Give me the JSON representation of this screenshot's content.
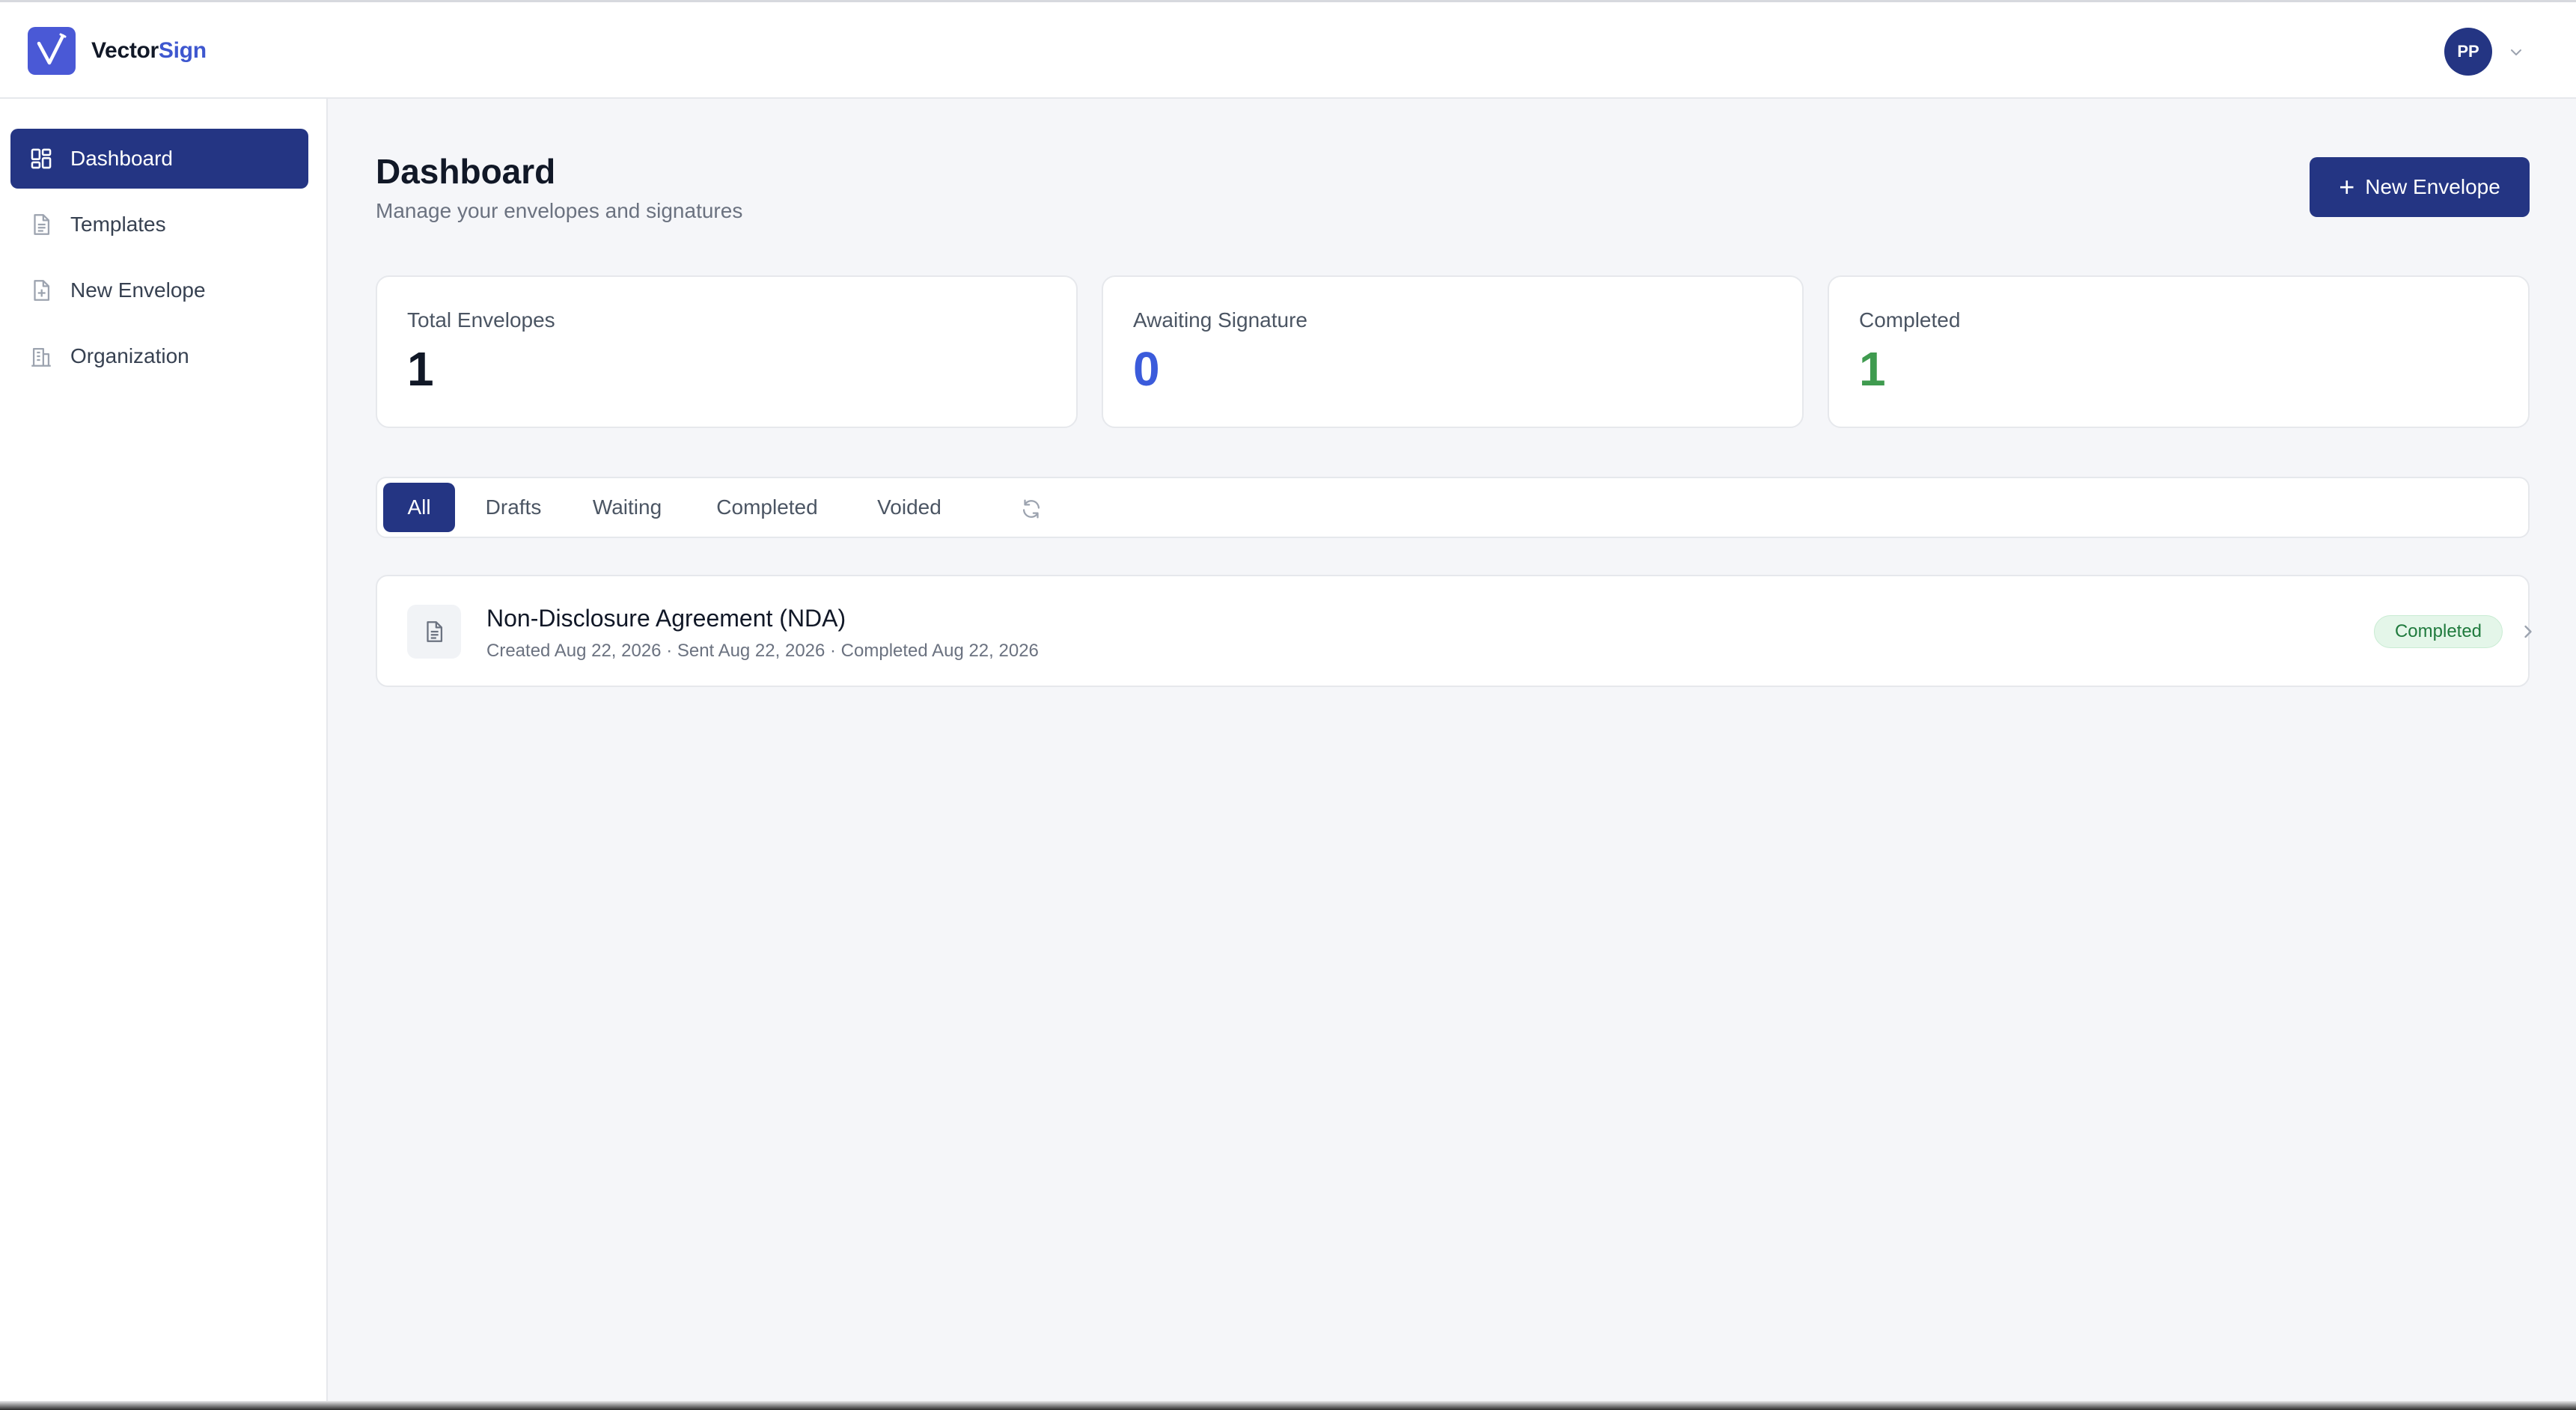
{
  "app": {
    "brand_primary": "Vector",
    "brand_accent": "Sign",
    "logo_icon": "checkmark-logo-icon",
    "accent_color": "#243583"
  },
  "user": {
    "initials": "PP",
    "menu_icon": "chevron-down-icon"
  },
  "sidebar": {
    "items": [
      {
        "label": "Dashboard",
        "icon": "dashboard-grid-icon",
        "active": true
      },
      {
        "label": "Templates",
        "icon": "document-icon",
        "active": false
      },
      {
        "label": "New Envelope",
        "icon": "document-plus-icon",
        "active": false
      },
      {
        "label": "Organization",
        "icon": "building-icon",
        "active": false
      }
    ]
  },
  "header": {
    "title": "Dashboard",
    "subtitle": "Manage your envelopes and signatures",
    "new_envelope_label": "New Envelope"
  },
  "stats": [
    {
      "label": "Total Envelopes",
      "value": "1",
      "color": "#111827"
    },
    {
      "label": "Awaiting Signature",
      "value": "0",
      "color": "#3b5bdb"
    },
    {
      "label": "Completed",
      "value": "1",
      "color": "#3f9b4f"
    }
  ],
  "filters": {
    "tabs": [
      {
        "label": "All",
        "active": true
      },
      {
        "label": "Drafts",
        "active": false
      },
      {
        "label": "Waiting",
        "active": false
      },
      {
        "label": "Completed",
        "active": false
      },
      {
        "label": "Voided",
        "active": false
      }
    ],
    "refresh_icon": "refresh-icon"
  },
  "envelopes": [
    {
      "title": "Non-Disclosure Agreement (NDA)",
      "meta": "Created Aug 22, 2026 · Sent Aug 22, 2026 · Completed Aug 22, 2026",
      "status": "Completed",
      "status_color": "#1f7a3d",
      "icon": "document-icon"
    }
  ]
}
